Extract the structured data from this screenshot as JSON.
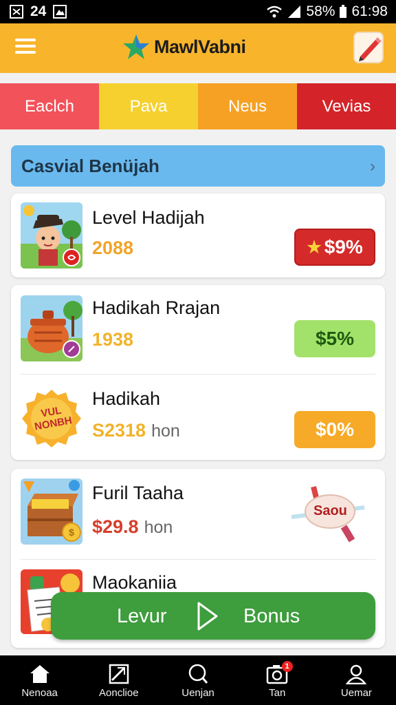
{
  "status_bar": {
    "time_left": "24",
    "battery": "58%",
    "clock": "61:98"
  },
  "header": {
    "app_name": "MawlVabni",
    "icons": {
      "menu": "hamburger-icon",
      "logo": "star-icon",
      "edit": "pencil-icon"
    }
  },
  "tabs": [
    {
      "label": "Eaclch",
      "color": "#f2525a"
    },
    {
      "label": "Pava",
      "color": "#f6d02f"
    },
    {
      "label": "Neus",
      "color": "#f6a124"
    },
    {
      "label": "Vevias",
      "color": "#d42429"
    }
  ],
  "section": {
    "title": "Casvial Benüjah"
  },
  "items": [
    {
      "title": "Level Hadijah",
      "price": "2088",
      "unit": "",
      "badge": "$9%",
      "badge_color": "#d42a2a",
      "thumb": "avatar-character-icon"
    },
    {
      "title": "Hadikah Rrajan",
      "price": "1938",
      "unit": "",
      "badge": "$5%",
      "badge_color": "#a3e26a",
      "thumb": "treasure-pot-icon"
    },
    {
      "title": "Hadikah",
      "price": "S2318",
      "unit": "hon",
      "badge": "$0%",
      "badge_color": "#f7aa28",
      "thumb": "sale-badge-icon",
      "thumb_text": "VUL NONBH"
    },
    {
      "title": "Furil Taaha",
      "price": "$29.8",
      "unit": "hon",
      "sticker": "Saou",
      "thumb": "treasure-chest-icon"
    },
    {
      "title": "Maokaniia",
      "price": "",
      "unit": "",
      "thumb": "document-icon"
    }
  ],
  "cta": {
    "left_label": "Levur",
    "right_label": "Bonus",
    "icon": "play-icon"
  },
  "bottom_nav": [
    {
      "label": "Nenoaa",
      "icon": "home-icon"
    },
    {
      "label": "Aonclioe",
      "icon": "image-icon"
    },
    {
      "label": "Uenjan",
      "icon": "search-icon"
    },
    {
      "label": "Tan",
      "icon": "camera-icon",
      "badge": "1"
    },
    {
      "label": "Uemar",
      "icon": "profile-icon"
    }
  ]
}
